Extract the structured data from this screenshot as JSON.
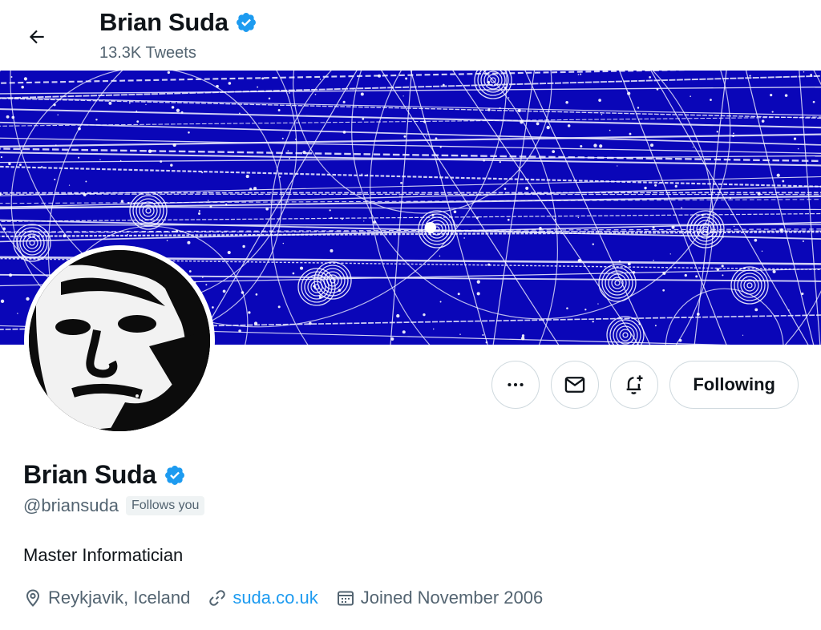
{
  "header": {
    "name": "Brian Suda",
    "tweet_count": "13.3K Tweets"
  },
  "actions": {
    "following_label": "Following"
  },
  "profile": {
    "name": "Brian Suda",
    "handle": "@briansuda",
    "follows_you": "Follows you",
    "bio": "Master Informatician",
    "location": "Reykjavik, Iceland",
    "website": "suda.co.uk",
    "joined": "Joined November 2006"
  },
  "icons": {
    "back": "back-arrow-icon",
    "verified": "verified-badge-icon",
    "more": "more-icon",
    "message": "envelope-icon",
    "notify": "bell-plus-icon",
    "location": "location-pin-icon",
    "link": "link-icon",
    "calendar": "calendar-icon"
  },
  "colors": {
    "verified": "#1d9bf0",
    "link": "#1d9bf0",
    "banner_bg": "#0a06b8",
    "secondary_text": "#536471"
  }
}
